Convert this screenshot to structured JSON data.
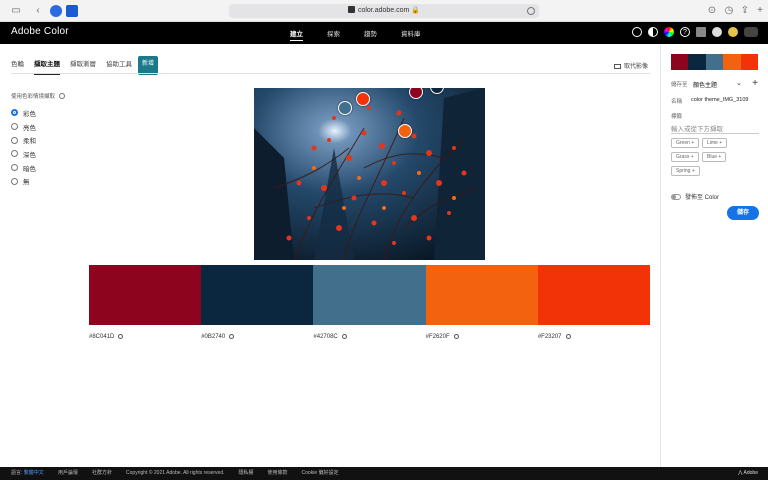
{
  "browser": {
    "url": "color.adobe.com"
  },
  "app": {
    "brand": "Adobe Color",
    "nav": [
      "建立",
      "探索",
      "趨勢",
      "資料庫"
    ]
  },
  "tabs": {
    "items": [
      "色輪",
      "擷取主題",
      "擷取漸層",
      "協助工具"
    ],
    "badge": "新增",
    "replace_image": "取代影像"
  },
  "mood": {
    "title": "使用色彩情境擷取",
    "options": [
      "彩色",
      "亮色",
      "柔和",
      "深色",
      "暗色",
      "無"
    ],
    "selected": "彩色"
  },
  "palette": {
    "colors": [
      "#8C041D",
      "#0B2740",
      "#42708C",
      "#F2620F",
      "#F23207"
    ],
    "labels": [
      "#8C041D",
      "#0B2740",
      "#42708C",
      "#F2620F",
      "#F23207"
    ]
  },
  "panel": {
    "save_to_label": "儲存至",
    "save_to_value": "顏色主題",
    "name_label": "名稱",
    "name_value": "color theme_IMG_3109",
    "tags_label": "標籤",
    "tags_placeholder": "輸入或從下方擷取",
    "tags": [
      "Green",
      "Lime",
      "Grass",
      "Blue",
      "Spring"
    ],
    "publish_label": "發佈至 Color",
    "save_button": "儲存"
  },
  "footer": {
    "lang_prefix": "語言:",
    "lang": "繁體中文",
    "links": [
      "用戶論壇",
      "社群方針",
      "Copyright © 2021 Adobe. All rights reserved.",
      "隱私權",
      "使用條款",
      "Cookie 偏好設定"
    ],
    "adobe": "Adobe"
  }
}
